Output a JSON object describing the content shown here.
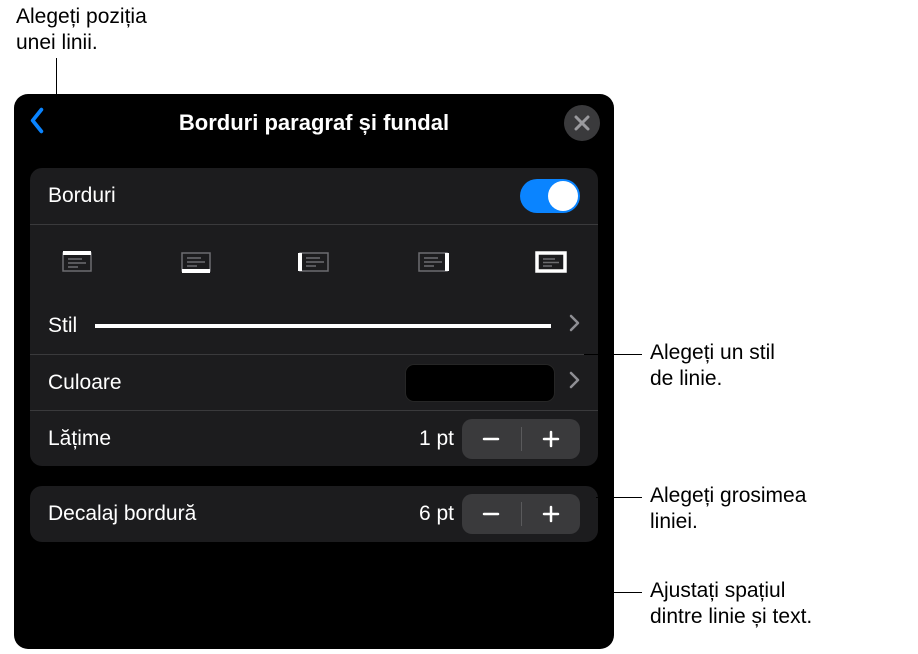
{
  "callouts": {
    "top": {
      "line1": "Alegeți poziția",
      "line2": "unei linii."
    },
    "style": {
      "line1": "Alegeți un stil",
      "line2": "de linie."
    },
    "width": {
      "line1": "Alegeți grosimea",
      "line2": "liniei."
    },
    "offset": {
      "line1": "Ajustați spațiul",
      "line2": "dintre linie și text."
    }
  },
  "panel": {
    "title": "Borduri paragraf și fundal",
    "borders": {
      "label": "Borduri",
      "enabled": true
    },
    "style": {
      "label": "Stil"
    },
    "color": {
      "label": "Culoare",
      "value": "#000000"
    },
    "width": {
      "label": "Lățime",
      "value": "1 pt"
    },
    "offset": {
      "label": "Decalaj bordură",
      "value": "6 pt"
    }
  }
}
